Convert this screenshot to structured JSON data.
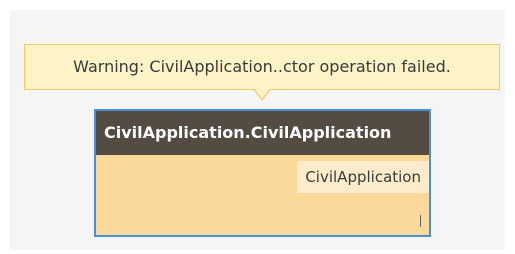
{
  "warning": {
    "text": "Warning: CivilApplication..ctor operation failed."
  },
  "node": {
    "title": "CivilApplication.CivilApplication",
    "output_port_label": "CivilApplication"
  },
  "colors": {
    "warning_background": "#fef3c7",
    "warning_border": "#f5c86a",
    "node_header": "#544b42",
    "node_body": "#fad99b",
    "node_selected_border": "#4a90d9"
  }
}
